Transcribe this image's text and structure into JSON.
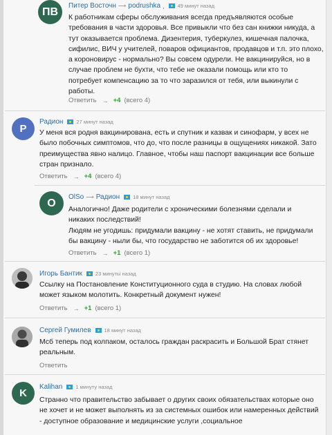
{
  "comments": [
    {
      "author": "Питер Восточн",
      "reply_to": "podrushka",
      "time": "49 минут назад",
      "avatar_text": "ПВ",
      "avatar_color": "#2f6850",
      "lines": [
        "К работникам сферы обслуживания всегда предъявляются особые",
        "требования в части здоровья. Все привыкли что без сан книжки никуда, а",
        "тут оказывается проблема. Дизентерия, туберкулез, кишечная палочка,",
        "сифилис, ВИЧ у учителей, поваров официантов, продавцов и т.п. это плохо,",
        "а короновирус - нормально? Вы совсем одурели. Не вакцинируйся, но в",
        "случае проблем не бухти, что тебе не оказали помощь или кто то",
        "потребует компенсацию за то что заразился от тебя, или выкинули с",
        "работы."
      ],
      "reply_label": "Ответить",
      "score": "+4",
      "total": "(всего 4)"
    },
    {
      "author": "Радион",
      "time": "27 минут назад",
      "avatar_text": "Р",
      "avatar_color": "#5270c0",
      "lines": [
        "У меня вся родня вакцинирована, есть и спутник и казвак и синофарм, у всех не",
        "было побочных симптомов, что до, что после разницы в ощущениях никакой. Зато",
        "преимущества явно налицо. Главное, чтобы наш паспорт вакцинации все больше",
        "стран признало."
      ],
      "reply_label": "Ответить",
      "score": "+4",
      "total": "(всего 4)"
    },
    {
      "author": "OlSo",
      "reply_to": "Радион",
      "time": "18 минут назад",
      "avatar_text": "O",
      "avatar_color": "#2f6850",
      "lines": [
        "Аналогично! Даже родители с хроническими болезнями сделали и",
        "никаких последствий!",
        "Людям не угодишь: придумали вакцину - не хотят ставить, не придумали",
        "бы вакцину - ныли бы, что государство не заботится об их здоровье!"
      ],
      "reply_label": "Ответить",
      "score": "+1",
      "total": "(всего 1)"
    },
    {
      "author": "Игорь Бантик",
      "time": "23 минуты назад",
      "lines": [
        "Ссылку на Постановление Конституционного суда в студию. На словах любой",
        "может языком молотить. Конкретный документ нужен!"
      ],
      "reply_label": "Ответить",
      "score": "+1",
      "total": "(всего 1)"
    },
    {
      "author": "Сергей Гумилев",
      "time": "18 минут назад",
      "lines": [
        "Мсб теперь под колпаком, осталось граждан раскрасить и Большой Брат стянет",
        "реальным."
      ],
      "reply_label": "Ответить"
    },
    {
      "author": "Kalihan",
      "time": "1 минуту назад",
      "avatar_text": "K",
      "avatar_color": "#2f6850",
      "lines": [
        "Странно что правительство забывает о других своих обязательствах которые оно",
        "не хочет и не может выполнять из за системных ошибок или намеренных действий",
        "- доступное образование и медицинские услуги ,социальное"
      ]
    }
  ]
}
